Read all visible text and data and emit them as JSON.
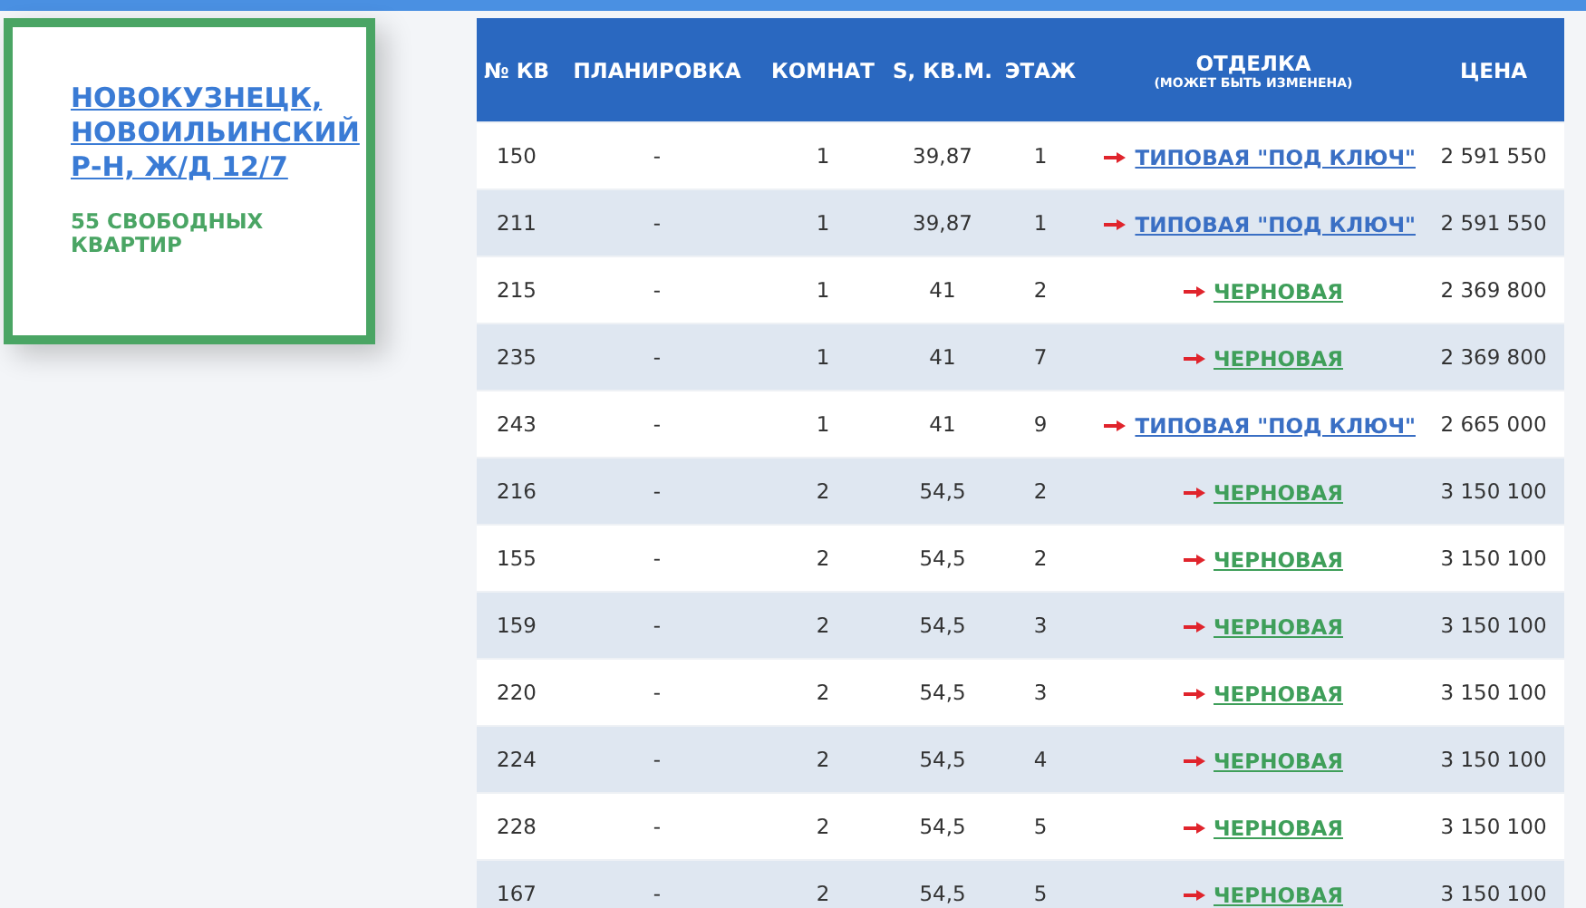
{
  "card": {
    "address": "НОВОКУЗНЕЦК, НОВОИЛЬИНСКИЙ Р-Н, Ж/Д 12/7",
    "free_count": "55 СВОБОДНЫХ КВАРТИР"
  },
  "table": {
    "columns": [
      "№ КВ",
      "ПЛАНИРОВКА",
      "КОМНАТ",
      "S, КВ.М.",
      "ЭТАЖ",
      "ОТДЕЛКА",
      "ЦЕНА"
    ],
    "finish_note": "(МОЖЕТ БЫТЬ ИЗМЕНЕНА)",
    "rows": [
      {
        "number": "150",
        "plan": "-",
        "rooms": "1",
        "area": "39,87",
        "floor": "1",
        "finish": "ТИПОВАЯ \"ПОД КЛЮЧ\"",
        "kind": "turnkey",
        "price": "2 591 550"
      },
      {
        "number": "211",
        "plan": "-",
        "rooms": "1",
        "area": "39,87",
        "floor": "1",
        "finish": "ТИПОВАЯ \"ПОД КЛЮЧ\"",
        "kind": "turnkey",
        "price": "2 591 550"
      },
      {
        "number": "215",
        "plan": "-",
        "rooms": "1",
        "area": "41",
        "floor": "2",
        "finish": "ЧЕРНОВАЯ",
        "kind": "rough",
        "price": "2 369 800"
      },
      {
        "number": "235",
        "plan": "-",
        "rooms": "1",
        "area": "41",
        "floor": "7",
        "finish": "ЧЕРНОВАЯ",
        "kind": "rough",
        "price": "2 369 800"
      },
      {
        "number": "243",
        "plan": "-",
        "rooms": "1",
        "area": "41",
        "floor": "9",
        "finish": "ТИПОВАЯ \"ПОД КЛЮЧ\"",
        "kind": "turnkey",
        "price": "2 665 000"
      },
      {
        "number": "216",
        "plan": "-",
        "rooms": "2",
        "area": "54,5",
        "floor": "2",
        "finish": "ЧЕРНОВАЯ",
        "kind": "rough",
        "price": "3 150 100"
      },
      {
        "number": "155",
        "plan": "-",
        "rooms": "2",
        "area": "54,5",
        "floor": "2",
        "finish": "ЧЕРНОВАЯ",
        "kind": "rough",
        "price": "3 150 100"
      },
      {
        "number": "159",
        "plan": "-",
        "rooms": "2",
        "area": "54,5",
        "floor": "3",
        "finish": "ЧЕРНОВАЯ",
        "kind": "rough",
        "price": "3 150 100"
      },
      {
        "number": "220",
        "plan": "-",
        "rooms": "2",
        "area": "54,5",
        "floor": "3",
        "finish": "ЧЕРНОВАЯ",
        "kind": "rough",
        "price": "3 150 100"
      },
      {
        "number": "224",
        "plan": "-",
        "rooms": "2",
        "area": "54,5",
        "floor": "4",
        "finish": "ЧЕРНОВАЯ",
        "kind": "rough",
        "price": "3 150 100"
      },
      {
        "number": "228",
        "plan": "-",
        "rooms": "2",
        "area": "54,5",
        "floor": "5",
        "finish": "ЧЕРНОВАЯ",
        "kind": "rough",
        "price": "3 150 100"
      },
      {
        "number": "167",
        "plan": "-",
        "rooms": "2",
        "area": "54,5",
        "floor": "5",
        "finish": "ЧЕРНОВАЯ",
        "kind": "rough",
        "price": "3 150 100"
      }
    ]
  }
}
